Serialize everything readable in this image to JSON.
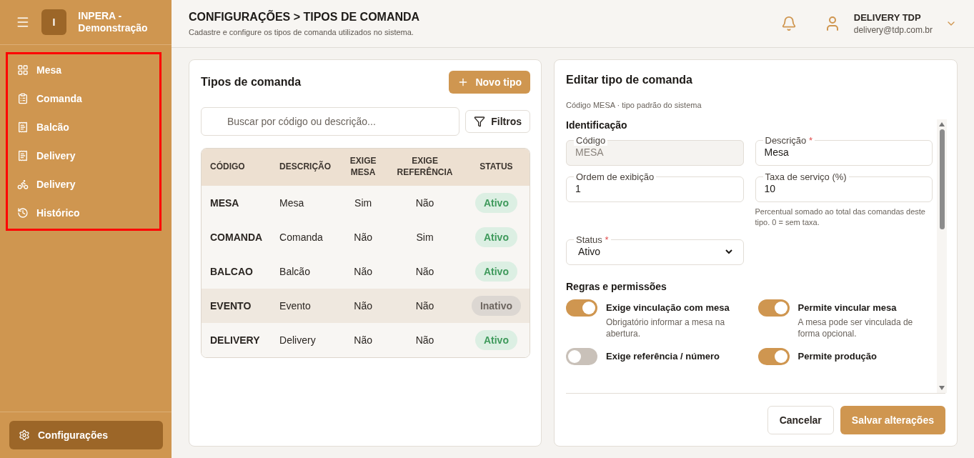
{
  "sidebar": {
    "logo_letter": "I",
    "brand": "INPERA - Demonstração",
    "highlight": true,
    "items": [
      {
        "label": "Mesa",
        "selected": false
      },
      {
        "label": "Comanda",
        "selected": false
      },
      {
        "label": "Balcão",
        "selected": false
      },
      {
        "label": "Delivery",
        "selected": false
      },
      {
        "label": "Delivery",
        "selected": false
      },
      {
        "label": "Histórico",
        "selected": false
      }
    ],
    "footer_item": {
      "label": "Configurações",
      "selected": true
    }
  },
  "header": {
    "title": "CONFIGURAÇÕES > TIPOS DE COMANDA",
    "subtitle": "Cadastre e configure os tipos de comanda utilizados no sistema.",
    "user_name": "DELIVERY TDP",
    "user_email": "delivery@tdp.com.br"
  },
  "list_panel": {
    "title": "Tipos de comanda",
    "new_button": "Novo tipo",
    "search": {
      "placeholder": "Buscar por código ou descrição..."
    },
    "filter_button": "Filtros",
    "table": {
      "columns": [
        "CÓDIGO",
        "DESCRIÇÃO",
        "EXIGE MESA",
        "EXIGE REFERÊNCIA",
        "STATUS"
      ],
      "rows": [
        {
          "code": "MESA",
          "description": "Mesa",
          "requires_table": "Sim",
          "requires_reference": "Não",
          "status": "Ativo",
          "active": true,
          "hovered": false
        },
        {
          "code": "COMANDA",
          "description": "Comanda",
          "requires_table": "Não",
          "requires_reference": "Sim",
          "status": "Ativo",
          "active": true,
          "hovered": false
        },
        {
          "code": "BALCAO",
          "description": "Balcão",
          "requires_table": "Não",
          "requires_reference": "Não",
          "status": "Ativo",
          "active": true,
          "hovered": false
        },
        {
          "code": "EVENTO",
          "description": "Evento",
          "requires_table": "Não",
          "requires_reference": "Não",
          "status": "Inativo",
          "active": false,
          "hovered": true
        },
        {
          "code": "DELIVERY",
          "description": "Delivery",
          "requires_table": "Não",
          "requires_reference": "Não",
          "status": "Ativo",
          "active": true,
          "hovered": false
        }
      ]
    }
  },
  "edit_panel": {
    "title": "Editar tipo de comanda",
    "subtitle": "Código MESA · tipo padrão do sistema",
    "section_identification": "Identificação",
    "fields": [
      {
        "label": "Código",
        "value": "MESA",
        "disabled": true
      },
      {
        "label": "Descrição",
        "value": "Mesa",
        "disabled": false,
        "mark": "*"
      },
      {
        "label": "Ordem de exibição",
        "value": "1",
        "disabled": false
      },
      {
        "label": "Taxa de serviço (%)",
        "value": "10",
        "disabled": false,
        "hint": "Percentual somado ao total das comandas deste tipo. 0 = sem taxa."
      }
    ],
    "status_field": {
      "label": "Status",
      "mark": "*",
      "value": "Ativo"
    },
    "section_rules": "Regras e permissões",
    "toggles": [
      {
        "label": "Exige vinculação com mesa",
        "description": "Obrigatório informar a mesa na abertura.",
        "on": true
      },
      {
        "label": "Permite vincular mesa",
        "description": "A mesa pode ser vinculada de forma opcional.",
        "on": true
      },
      {
        "label": "Exige referência / número",
        "on": false
      },
      {
        "label": "Permite produção",
        "on": true
      }
    ],
    "cancel_button": "Cancelar",
    "save_button": "Salvar alterações"
  }
}
